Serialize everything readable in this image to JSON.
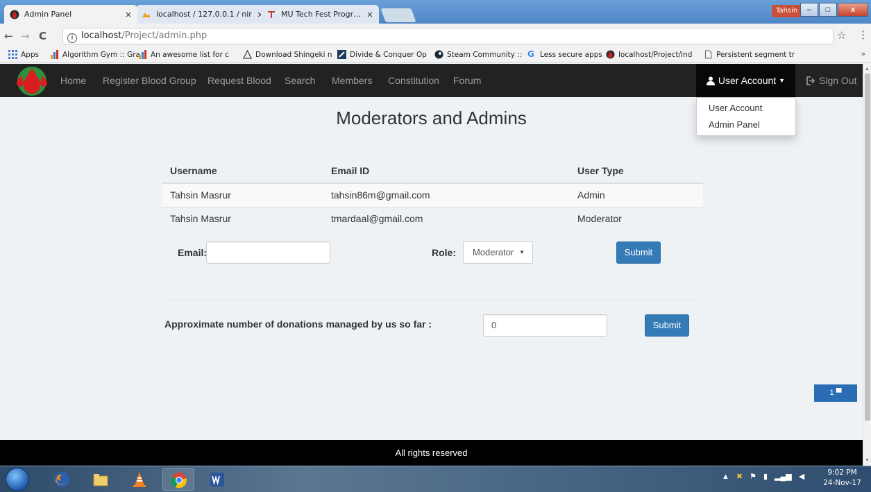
{
  "browser": {
    "tabs": [
      {
        "title": "Admin Panel",
        "close": "×"
      },
      {
        "title": "localhost / 127.0.0.1 / nir",
        "close": "×"
      },
      {
        "title": "MU Tech Fest Programm",
        "close": "×"
      }
    ],
    "profile_name": "Tahsin",
    "window_controls": {
      "minimize": "–",
      "maximize": "□",
      "close": "x"
    },
    "nav": {
      "back": "←",
      "forward": "→",
      "reload": "C"
    },
    "url_host": "localhost",
    "url_path": "/Project/admin.php",
    "bookmarks": [
      "Apps",
      "Algorithm Gym :: Gra",
      "An awesome list for c",
      "Download Shingeki n",
      "Divide & Conquer Op",
      "Steam Community ::",
      "Less secure apps",
      "localhost/Project/ind",
      "Persistent segment tr"
    ],
    "bookmarks_more": "»"
  },
  "navbar": {
    "links": [
      "Home",
      "Register Blood Group",
      "Request Blood",
      "Search",
      "Members",
      "Constitution",
      "Forum"
    ],
    "user_account": "User Account",
    "sign_out": "Sign Out"
  },
  "dropdown": {
    "items": [
      "User Account",
      "Admin Panel"
    ]
  },
  "main": {
    "heading": "Moderators and Admins",
    "table": {
      "headers": [
        "Username",
        "Email ID",
        "User Type"
      ],
      "rows": [
        [
          "Tahsin Masrur",
          "tahsin86m@gmail.com",
          "Admin"
        ],
        [
          "Tahsin Masrur",
          "tmardaal@gmail.com",
          "Moderator"
        ]
      ]
    },
    "form": {
      "email_label": "Email:",
      "email_value": "",
      "role_label": "Role:",
      "role_selected": "Moderator",
      "submit": "Submit"
    },
    "donations": {
      "label": "Approximate number of donations managed by us so far :",
      "value": "0",
      "submit": "Submit"
    }
  },
  "footer": {
    "text": "All rights reserved",
    "chat_count": "1"
  },
  "taskbar": {
    "time": "9:02 PM",
    "date": "24-Nov-17"
  },
  "colors": {
    "navbar_bg": "#222222",
    "primary_button": "#337ab7",
    "page_bg": "#eef2f5",
    "footer_bg": "#000000"
  }
}
